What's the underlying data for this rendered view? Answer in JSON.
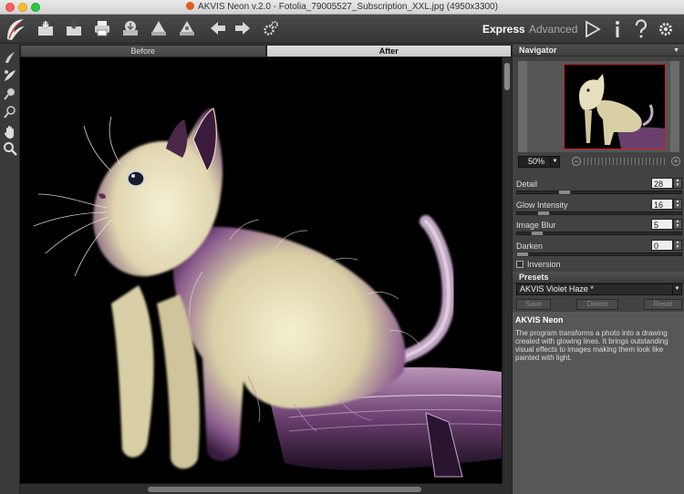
{
  "window": {
    "title": "AKVIS Neon v.2.0 - Fotolia_79005527_Subscription_XXL.jpg (4950x3300)"
  },
  "toolbar": {
    "modes": {
      "express": "Express",
      "advanced": "Advanced"
    }
  },
  "view": {
    "tabs": {
      "before": "Before",
      "after": "After"
    }
  },
  "navigator": {
    "header": "Navigator",
    "zoom": "50%",
    "zoom_out": "−",
    "zoom_in": "+"
  },
  "params": {
    "detail": {
      "label": "Detail",
      "value": "28"
    },
    "glow": {
      "label": "Glow Intensity",
      "value": "16"
    },
    "blur": {
      "label": "Image Blur",
      "value": "5"
    },
    "darken": {
      "label": "Darken",
      "value": "0"
    }
  },
  "inversion": {
    "label": "Inversion"
  },
  "presets": {
    "header": "Presets",
    "selected": "AKVIS Violet Haze *",
    "save": "Save",
    "delete": "Delete",
    "reset": "Reset"
  },
  "about": {
    "heading": "AKVIS Neon",
    "text": "The program transforms a photo into a drawing created with glowing lines. It brings outstanding visual effects to images making them look like painted with light."
  },
  "colors": {
    "accent_red": "#cc2222",
    "neon_cream": "#f2edc8",
    "neon_violet": "#8a5a9a"
  }
}
